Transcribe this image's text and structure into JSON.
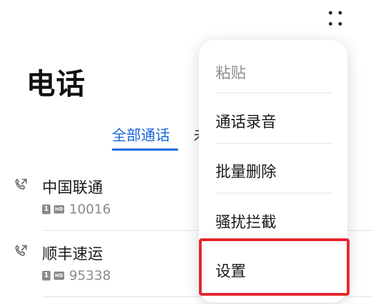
{
  "header": {
    "title": "电话",
    "more_icon": "more-dots-icon"
  },
  "tabs": [
    {
      "label": "全部通话",
      "active": true
    },
    {
      "label": "未",
      "active": false
    }
  ],
  "calls": [
    {
      "name": "中国联通",
      "sim": "1",
      "hd": "HD",
      "number": "10016",
      "icon": "outgoing-call-icon"
    },
    {
      "name": "顺丰速运",
      "sim": "1",
      "hd": "HD",
      "number": "95338",
      "icon": "outgoing-call-icon"
    }
  ],
  "menu": {
    "items": [
      {
        "label": "粘贴",
        "enabled": false
      },
      {
        "label": "通话录音",
        "enabled": true
      },
      {
        "label": "批量删除",
        "enabled": true
      },
      {
        "label": "骚扰拦截",
        "enabled": true
      },
      {
        "label": "设置",
        "enabled": true,
        "highlighted": true
      }
    ]
  },
  "colors": {
    "accent": "#1766d9",
    "highlight": "#e8242c",
    "secondary_text": "#8a8a8a"
  }
}
